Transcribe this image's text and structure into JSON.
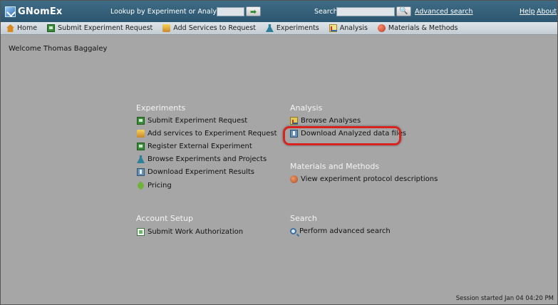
{
  "app": {
    "name": "GNomEx"
  },
  "header": {
    "lookup_label": "Lookup by Experiment or Analysis #",
    "lookup_value": "",
    "search_label": "Search",
    "search_value": "",
    "advanced_search_link": "Advanced search",
    "help_link": "Help",
    "about_link": "About"
  },
  "nav": {
    "items": [
      {
        "label": "Home",
        "icon": "home-icon"
      },
      {
        "label": "Submit Experiment Request",
        "icon": "request-icon"
      },
      {
        "label": "Add Services to Request",
        "icon": "services-icon"
      },
      {
        "label": "Experiments",
        "icon": "flask-icon"
      },
      {
        "label": "Analysis",
        "icon": "chart-icon"
      },
      {
        "label": "Materials & Methods",
        "icon": "materials-icon"
      }
    ]
  },
  "welcome": "Welcome Thomas Baggaley",
  "sections": {
    "experiments": {
      "title": "Experiments",
      "links": [
        "Submit Experiment Request",
        "Add services to Experiment Request",
        "Register External Experiment",
        "Browse Experiments and Projects",
        "Download Experiment Results",
        "Pricing"
      ]
    },
    "analysis": {
      "title": "Analysis",
      "links": [
        "Browse Analyses",
        "Download Analyzed data files"
      ]
    },
    "materials": {
      "title": "Materials and Methods",
      "links": [
        "View experiment protocol descriptions"
      ]
    },
    "account": {
      "title": "Account Setup",
      "links": [
        "Submit Work Authorization"
      ]
    },
    "search": {
      "title": "Search",
      "links": [
        "Perform advanced search"
      ]
    }
  },
  "status": {
    "session": "Session started Jan 04 04:20 PM"
  },
  "colors": {
    "highlight": "#d8231e",
    "header": "#3e6b86"
  }
}
